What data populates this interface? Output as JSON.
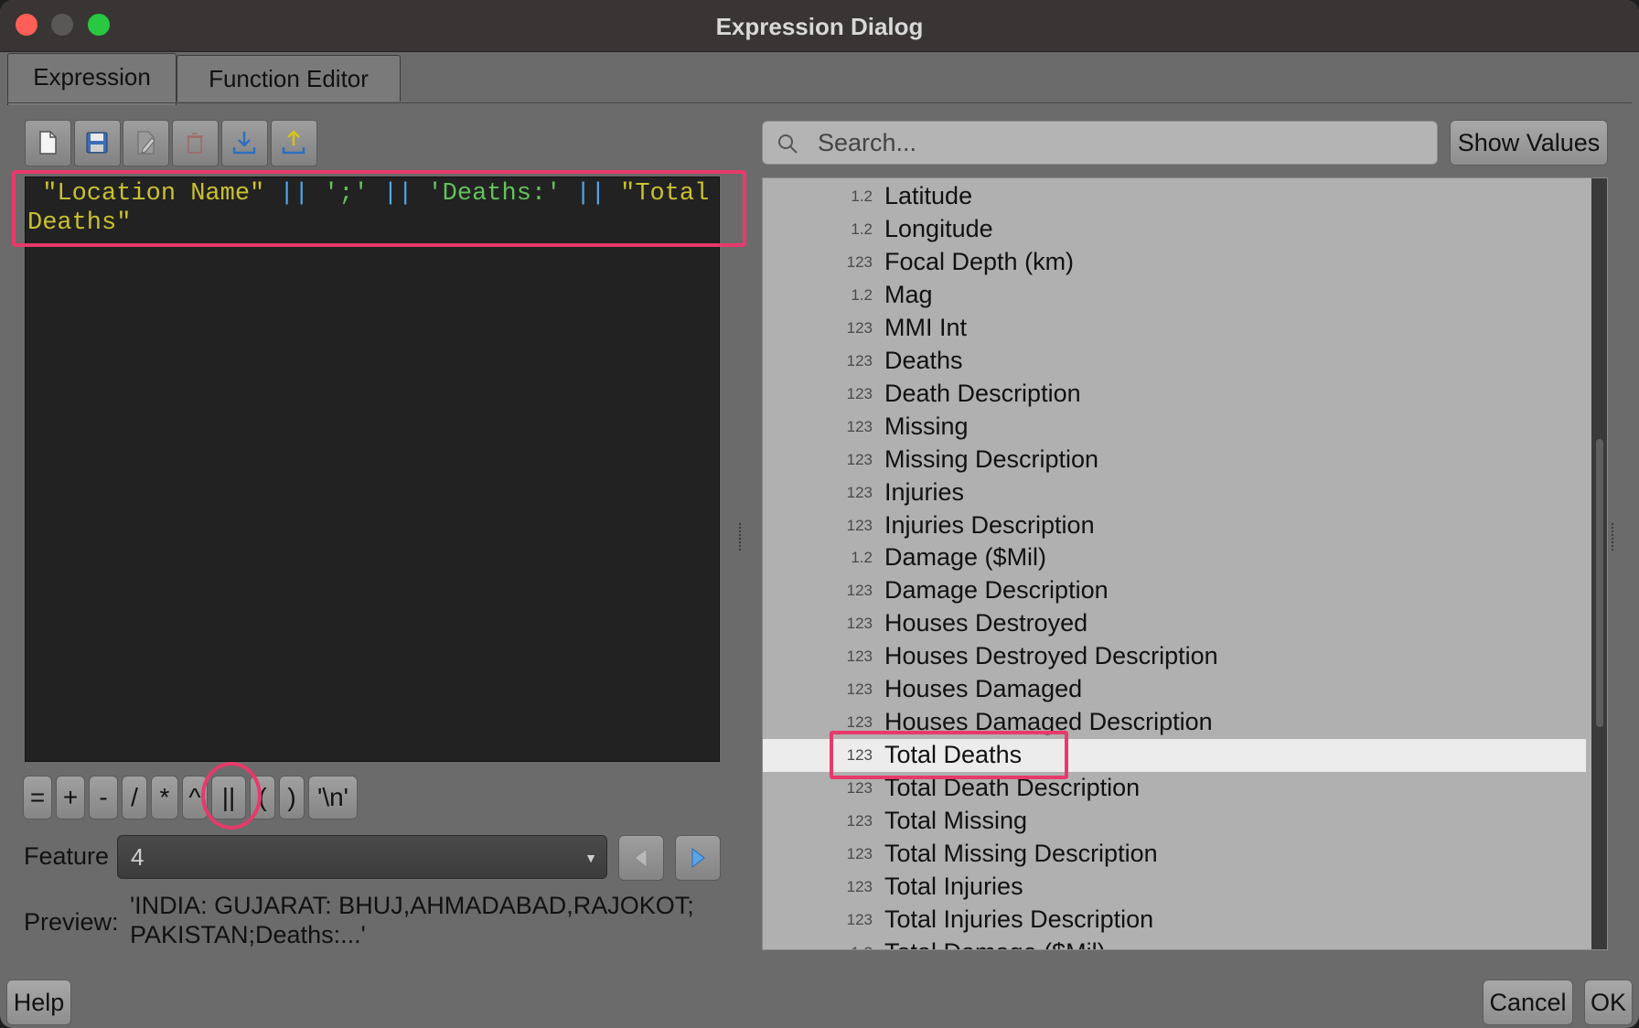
{
  "window": {
    "title": "Expression Dialog"
  },
  "tabs": [
    {
      "label": "Expression",
      "active": true
    },
    {
      "label": "Function Editor",
      "active": false
    }
  ],
  "toolbar": {
    "buttons": [
      "new-file-icon",
      "save-icon",
      "edit-icon",
      "delete-icon",
      "import-icon",
      "export-icon"
    ]
  },
  "editor": {
    "tokens": [
      {
        "type": "field",
        "text": " \"Location Name\" "
      },
      {
        "type": "op",
        "text": "||"
      },
      {
        "type": "str",
        "text": " ';' "
      },
      {
        "type": "op",
        "text": "||"
      },
      {
        "type": "str",
        "text": " 'Deaths:' "
      },
      {
        "type": "op",
        "text": "||"
      },
      {
        "type": "field",
        "text": " \"Total Deaths\""
      }
    ]
  },
  "operators": [
    "=",
    "+",
    "-",
    "/",
    "*",
    "^",
    "||",
    "(",
    ")",
    "'\\n'"
  ],
  "feature": {
    "label": "Feature",
    "value": "4"
  },
  "preview": {
    "label": "Preview:",
    "value": "'INDIA:  GUJARAT:  BHUJ,AHMADABAD,RAJOKOT; PAKISTAN;Deaths:...'"
  },
  "search": {
    "placeholder": "Search..."
  },
  "show_values_label": "Show Values",
  "fields": [
    {
      "type": "1.2",
      "name": "Latitude"
    },
    {
      "type": "1.2",
      "name": "Longitude"
    },
    {
      "type": "123",
      "name": "Focal Depth (km)"
    },
    {
      "type": "1.2",
      "name": "Mag"
    },
    {
      "type": "123",
      "name": "MMI Int"
    },
    {
      "type": "123",
      "name": "Deaths"
    },
    {
      "type": "123",
      "name": "Death Description"
    },
    {
      "type": "123",
      "name": "Missing"
    },
    {
      "type": "123",
      "name": "Missing Description"
    },
    {
      "type": "123",
      "name": "Injuries"
    },
    {
      "type": "123",
      "name": "Injuries Description"
    },
    {
      "type": "1.2",
      "name": "Damage ($Mil)"
    },
    {
      "type": "123",
      "name": "Damage Description"
    },
    {
      "type": "123",
      "name": "Houses Destroyed"
    },
    {
      "type": "123",
      "name": "Houses Destroyed Description"
    },
    {
      "type": "123",
      "name": "Houses Damaged"
    },
    {
      "type": "123",
      "name": "Houses Damaged Description"
    },
    {
      "type": "123",
      "name": "Total Deaths",
      "selected": true
    },
    {
      "type": "123",
      "name": "Total Death Description"
    },
    {
      "type": "123",
      "name": "Total Missing"
    },
    {
      "type": "123",
      "name": "Total Missing Description"
    },
    {
      "type": "123",
      "name": "Total Injuries"
    },
    {
      "type": "123",
      "name": "Total Injuries Description"
    },
    {
      "type": "1.2",
      "name": "Total Damage ($Mil)"
    }
  ],
  "buttons": {
    "help": "Help",
    "cancel": "Cancel",
    "ok": "OK"
  },
  "colors": {
    "highlight": "#e8396c",
    "field_token": "#c9c12f",
    "operator_token": "#4fa8e8",
    "string_token": "#62c25b"
  }
}
